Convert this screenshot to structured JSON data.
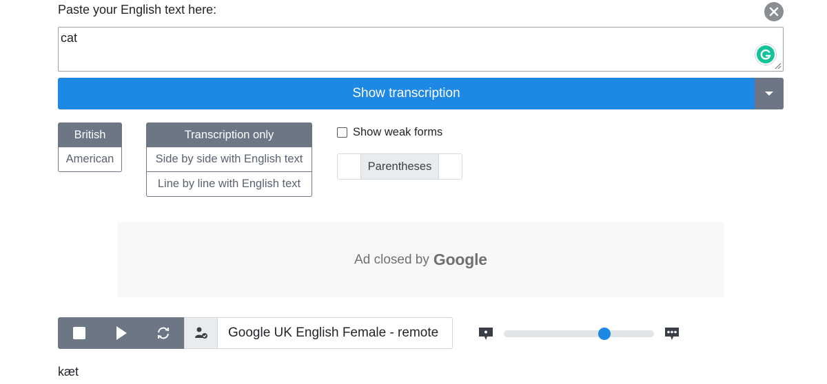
{
  "header": {
    "paste_label": "Paste your English text here:"
  },
  "text_input": {
    "value": "cat"
  },
  "buttons": {
    "show_transcription": "Show transcription"
  },
  "accent_options": [
    {
      "label": "British",
      "selected": true
    },
    {
      "label": "American",
      "selected": false
    }
  ],
  "mode_options": [
    {
      "label": "Transcription only",
      "selected": true
    },
    {
      "label": "Side by side with English text",
      "selected": false
    },
    {
      "label": "Line by line with English text",
      "selected": false
    }
  ],
  "weak_forms": {
    "label": "Show weak forms",
    "checked": false
  },
  "weak_form_style": {
    "selected": "Parentheses"
  },
  "ad": {
    "text": "Ad closed by",
    "brand": "Google"
  },
  "player": {
    "voice": "Google UK English Female - remote",
    "speed_fraction": 0.67
  },
  "result": {
    "transcription": "kæt"
  },
  "colors": {
    "primary": "#1e88e5",
    "secondary": "#6c7685",
    "grammarly": "#15c39a"
  },
  "icons": [
    "close-icon",
    "grammarly-icon",
    "chevron-down-icon",
    "stop-icon",
    "play-icon",
    "loop-icon",
    "voice-settings-icon",
    "speech-slow-icon",
    "speech-fast-icon"
  ]
}
